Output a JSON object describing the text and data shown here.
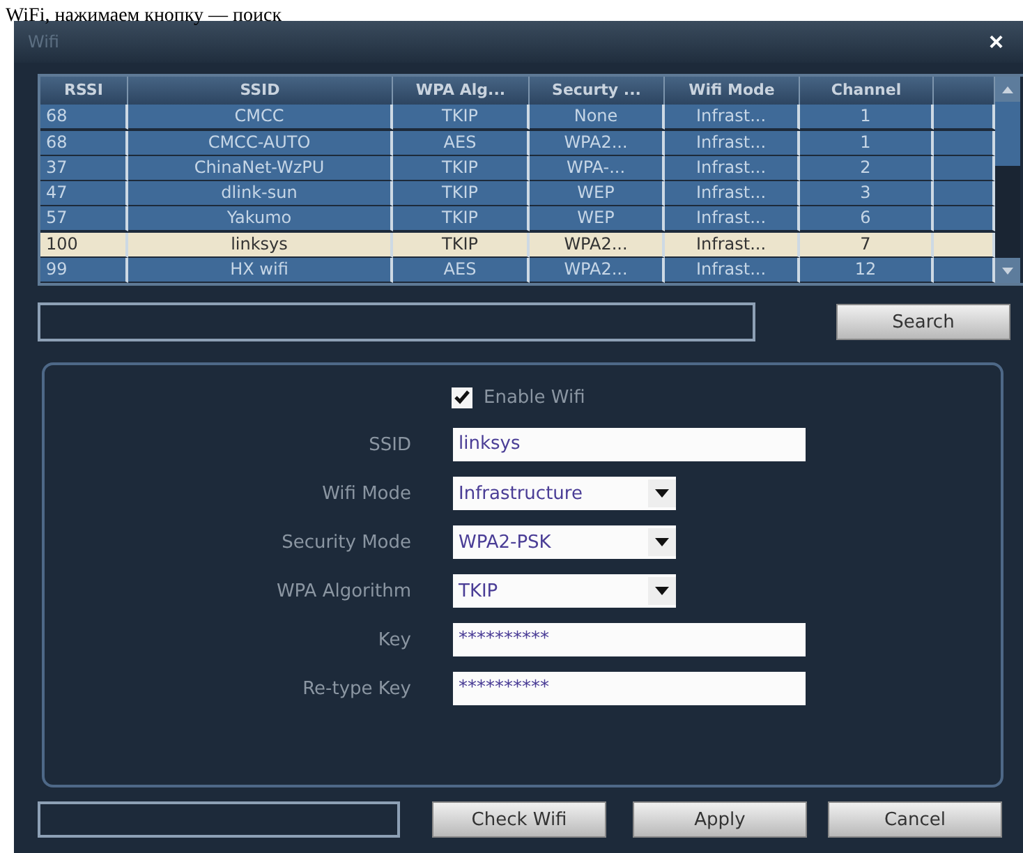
{
  "caption": "WiFi, нажимаем кнопку — поиск",
  "window": {
    "title": "Wifi",
    "close": "×"
  },
  "table": {
    "columns": [
      "RSSI",
      "SSID",
      "WPA Alg...",
      "Securty ...",
      "Wifi Mode",
      "Channel"
    ],
    "rows": [
      {
        "cells": [
          "68",
          "CMCC",
          "TKIP",
          "None",
          "Infrast...",
          "1"
        ],
        "selected": false
      },
      {
        "cells": [
          "68",
          "CMCC-AUTO",
          "AES",
          "WPA2...",
          "Infrast...",
          "1"
        ],
        "selected": false
      },
      {
        "cells": [
          "37",
          "ChinaNet-WzPU",
          "TKIP",
          "WPA-...",
          "Infrast...",
          "2"
        ],
        "selected": false
      },
      {
        "cells": [
          "47",
          "dlink-sun",
          "TKIP",
          "WEP",
          "Infrast...",
          "3"
        ],
        "selected": false
      },
      {
        "cells": [
          "57",
          "Yakumo",
          "TKIP",
          "WEP",
          "Infrast...",
          "6"
        ],
        "selected": false
      },
      {
        "cells": [
          "100",
          "linksys",
          "TKIP",
          "WPA2...",
          "Infrast...",
          "7"
        ],
        "selected": true
      },
      {
        "cells": [
          "99",
          "HX wifi",
          "AES",
          "WPA2...",
          "Infrast...",
          "12"
        ],
        "selected": false
      }
    ]
  },
  "search_button": "Search",
  "form": {
    "enable_wifi": {
      "label": "Enable Wifi",
      "checked": true
    },
    "fields": [
      {
        "kind": "text",
        "label": "SSID",
        "value": "linksys"
      },
      {
        "kind": "select",
        "label": "Wifi Mode",
        "value": "Infrastructure"
      },
      {
        "kind": "select",
        "label": "Security Mode",
        "value": "WPA2-PSK"
      },
      {
        "kind": "select",
        "label": "WPA Algorithm",
        "value": "TKIP"
      },
      {
        "kind": "text",
        "label": "Key",
        "value": "**********"
      },
      {
        "kind": "text",
        "label": "Re-type Key",
        "value": "**********"
      }
    ]
  },
  "buttons": [
    "Check Wifi",
    "Apply",
    "Cancel"
  ]
}
